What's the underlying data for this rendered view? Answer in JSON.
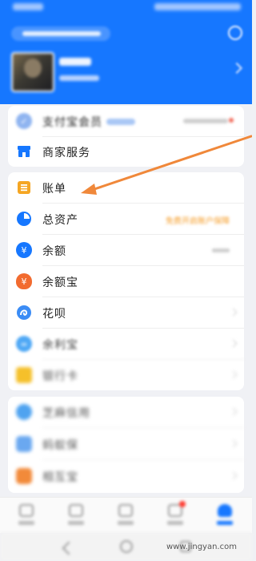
{
  "header": {
    "background": "#1677ff"
  },
  "card1": {
    "items": [
      {
        "label": "支付宝会员",
        "icon": "member-shield-icon",
        "color": "#8fb4f0",
        "blurred": true
      },
      {
        "label": "商家服务",
        "icon": "storefront-icon",
        "color": "#1677ff",
        "blurred": false
      }
    ]
  },
  "card2": {
    "items": [
      {
        "label": "账单",
        "icon": "bill-icon",
        "color": "#f5a623",
        "right": ""
      },
      {
        "label": "总资产",
        "icon": "pie-chart-icon",
        "color": "#1677ff",
        "right": "免费开启账户保障"
      },
      {
        "label": "余额",
        "icon": "yuan-coin-icon",
        "color": "#1677ff",
        "right": ""
      },
      {
        "label": "余额宝",
        "icon": "money-bag-icon",
        "color": "#f26b2f",
        "right": ""
      },
      {
        "label": "花呗",
        "icon": "huabei-icon",
        "color": "#3b8cf5",
        "right": ""
      },
      {
        "label": "余利宝",
        "icon": "yulibao-icon",
        "color": "#4fa8f5",
        "right": ""
      },
      {
        "label": "银行卡",
        "icon": "bank-card-icon",
        "color": "#f5c02a",
        "right": ""
      }
    ]
  },
  "card3": {
    "items": [
      {
        "label": "芝麻信用",
        "icon": "sesame-credit-icon",
        "color": "#4fa3f0"
      },
      {
        "label": "蚂蚁保",
        "icon": "insurance-icon",
        "color": "#6aa8f0"
      },
      {
        "label": "相互宝",
        "icon": "mutual-aid-icon",
        "color": "#f28a3a"
      }
    ]
  },
  "tabbar": {
    "tabs": [
      {
        "icon": "home-tab-icon",
        "active": false
      },
      {
        "icon": "wealth-tab-icon",
        "active": false
      },
      {
        "icon": "video-tab-icon",
        "active": false
      },
      {
        "icon": "message-tab-icon",
        "active": false,
        "badge": true
      },
      {
        "icon": "mine-tab-icon",
        "active": true
      }
    ]
  },
  "watermark": "www.jingyan.com",
  "annotation_color": "#f0883a"
}
